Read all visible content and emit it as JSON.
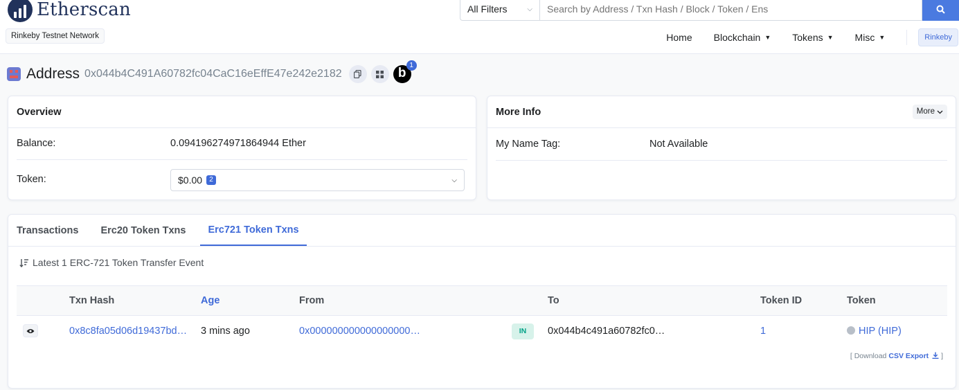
{
  "header": {
    "brand": "Etherscan",
    "network_badge": "Rinkeby Testnet Network",
    "search": {
      "filter": "All Filters",
      "placeholder": "Search by Address / Txn Hash / Block / Token / Ens"
    },
    "nav": [
      "Home",
      "Blockchain",
      "Tokens",
      "Misc"
    ],
    "network_button": "Rinkeby"
  },
  "address": {
    "label": "Address",
    "value": "0x044b4C491A60782fc04CaC16eEffE47e242e2182",
    "badge_letter": "b",
    "badge_count": "1"
  },
  "overview": {
    "title": "Overview",
    "balance_label": "Balance:",
    "balance_value": "0.094196274971864944 Ether",
    "token_label": "Token:",
    "token_value": "$0.00",
    "token_count": "2"
  },
  "more_info": {
    "title": "More Info",
    "more_button": "More",
    "name_tag_label": "My Name Tag:",
    "name_tag_value": "Not Available"
  },
  "tabs": [
    "Transactions",
    "Erc20 Token Txns",
    "Erc721 Token Txns"
  ],
  "active_tab": "Erc721 Token Txns",
  "transfers": {
    "summary": "Latest 1 ERC-721 Token Transfer Event",
    "columns": [
      "Txn Hash",
      "Age",
      "From",
      "To",
      "Token ID",
      "Token"
    ],
    "rows": [
      {
        "txn_hash": "0x8c8fa05d06d19437bd…",
        "age": "3 mins ago",
        "from": "0x000000000000000000…",
        "direction": "IN",
        "to": "0x044b4c491a60782fc0…",
        "token_id": "1",
        "token": "HIP (HIP)"
      }
    ],
    "export_prefix": "[ Download",
    "export_link": "CSV Export",
    "export_suffix": "]"
  },
  "colors": {
    "accent": "#3f6ad8",
    "brand": "#21325b",
    "in_badge_bg": "#d7f2ea",
    "in_badge_text": "#00a186"
  }
}
